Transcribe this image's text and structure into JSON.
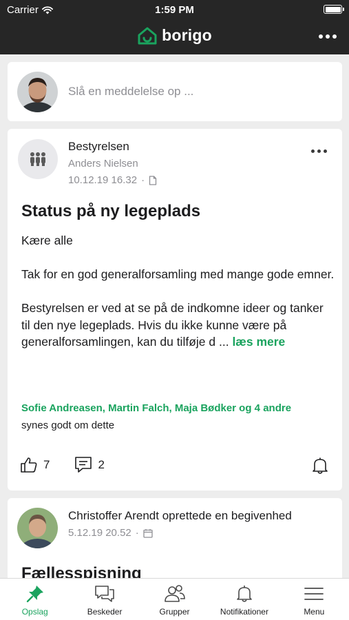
{
  "status_bar": {
    "carrier": "Carrier",
    "time": "1:59 PM"
  },
  "header": {
    "brand": "borigo"
  },
  "compose": {
    "placeholder": "Slå en meddelelse op ..."
  },
  "post": {
    "group": "Bestyrelsen",
    "author": "Anders Nielsen",
    "date": "10.12.19 16.32",
    "separator": "·",
    "title": "Status på ny legeplads",
    "greeting": "Kære alle",
    "paragraph1": "Tak for en god generalforsamling med mange gode emner.",
    "paragraph2": "Bestyrelsen er ved at se på de indkomne ideer og tanker til den nye legeplads. Hvis du ikke kunne være på generalforsamlingen, kan du tilføje d ...",
    "read_more": "læs mere",
    "likers": "Sofie Andreasen, Martin Falch, Maja Bødker og 4 andre",
    "likes_text": "synes godt om dette",
    "like_count": "7",
    "comment_count": "2"
  },
  "post2": {
    "headline": "Christoffer Arendt oprettede en begivenhed",
    "date": "5.12.19 20.52",
    "separator": "·",
    "title": "Fællesspisning"
  },
  "tabs": [
    {
      "label": "Opslag",
      "icon": "pin-icon",
      "active": true
    },
    {
      "label": "Beskeder",
      "icon": "chat-icon",
      "active": false
    },
    {
      "label": "Grupper",
      "icon": "group-icon",
      "active": false
    },
    {
      "label": "Notifikationer",
      "icon": "bell-icon",
      "active": false
    },
    {
      "label": "Menu",
      "icon": "menu-icon",
      "active": false
    }
  ],
  "colors": {
    "accent": "#1aa35e",
    "topbar": "#262626",
    "background": "#ededed"
  }
}
